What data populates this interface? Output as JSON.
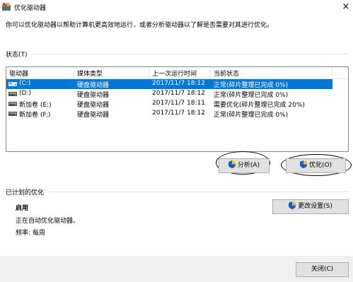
{
  "window": {
    "title": "优化驱动器",
    "close_glyph": "×"
  },
  "intro": "你可以优化驱动器以帮助计算机更高效地运行，或者分析驱动器以了解是否需要对其进行优化。",
  "status_section": {
    "label": "状态(T)"
  },
  "table": {
    "columns": [
      "驱动器",
      "媒体类型",
      "上一次运行时间",
      "当前状态"
    ],
    "rows": [
      {
        "drive": "(C:)",
        "media": "硬盘驱动器",
        "last_run": "2017/11/7 18:12",
        "status": "正常(碎片整理已完成 0%)",
        "selected": true
      },
      {
        "drive": "(D:)",
        "media": "硬盘驱动器",
        "last_run": "2017/11/7 18:12",
        "status": "正常(碎片整理已完成 0%)",
        "selected": false
      },
      {
        "drive": "新加卷 (E:)",
        "media": "硬盘驱动器",
        "last_run": "2017/11/7 18:11",
        "status": "需要优化(碎片整理已完成 20%)",
        "selected": false
      },
      {
        "drive": "新加卷 (F:)",
        "media": "硬盘驱动器",
        "last_run": "2017/11/7 18:12",
        "status": "正常(碎片整理已完成 0%)",
        "selected": false
      }
    ]
  },
  "buttons": {
    "analyze": "分析(A)",
    "optimize": "优化(O)",
    "change_settings": "更改设置(S)",
    "close": "关闭(C)"
  },
  "schedule": {
    "label": "已计划的优化",
    "state": "启用",
    "description": "正在自动优化驱动器。",
    "frequency": "频率: 每周"
  },
  "colors": {
    "selection": "#0078d7",
    "button_face": "#e1e1e1",
    "footer": "#f0f0f0"
  }
}
